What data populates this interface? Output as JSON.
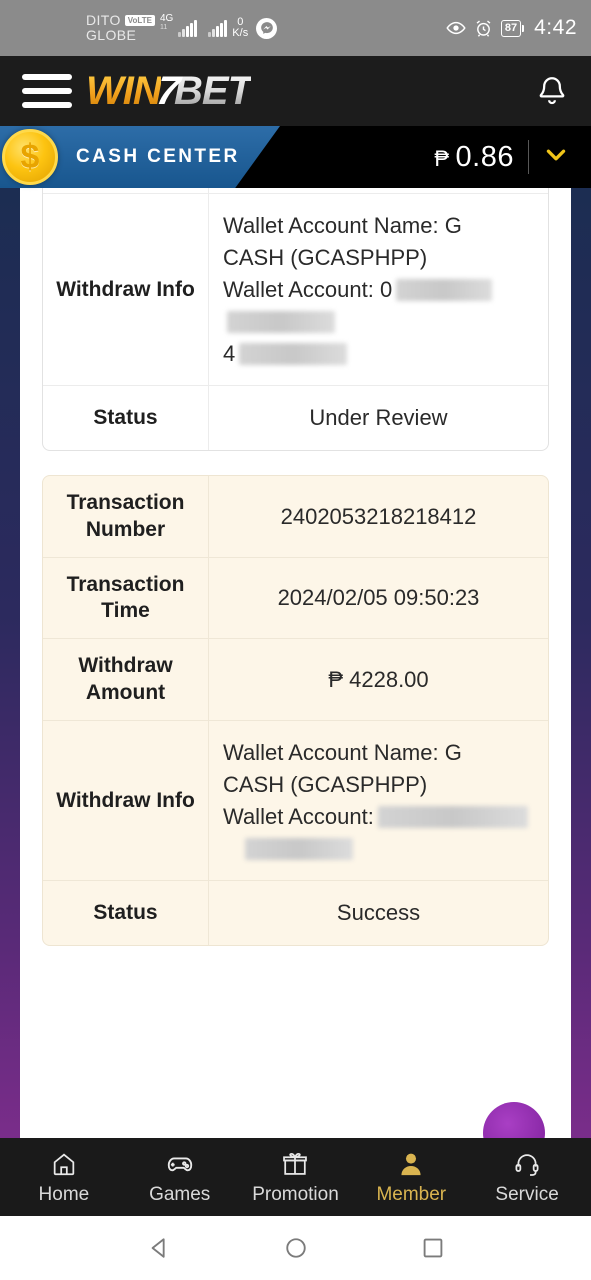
{
  "status_bar": {
    "carrier_primary": "DITO",
    "carrier_badge": "VoLTE",
    "carrier_secondary": "GLOBE",
    "network_type": "4G",
    "network_sub": "11",
    "data_rate_value": "0",
    "data_rate_unit": "K/s",
    "messenger_icon": "messenger-icon",
    "eye_icon": "eye-icon",
    "alarm_icon": "alarm-clock-icon",
    "battery_level": "87",
    "time": "4:42"
  },
  "header": {
    "menu_icon": "hamburger-menu-icon",
    "logo_win": "WIN",
    "logo_seven": "7",
    "logo_bet": "BET",
    "bell_icon": "notification-bell-icon"
  },
  "cash_center": {
    "coin_icon": "dollar-coin-icon",
    "title": "CASH CENTER",
    "currency_symbol": "₱",
    "balance": "0.86",
    "chevron_icon": "chevron-down-icon"
  },
  "transactions": [
    {
      "theme": "white",
      "partial_top": true,
      "rows": [
        {
          "label": "Withdraw Info",
          "type": "wallet",
          "wallet_name_line": "Wallet Account Name: G",
          "wallet_name_line2": "CASH (GCASPHPP)",
          "wallet_account_label": "Wallet Account:",
          "wallet_account_visible": "0",
          "wallet_account_visible2": "4",
          "redacted": true
        },
        {
          "label": "Status",
          "type": "text",
          "value": "Under Review"
        }
      ]
    },
    {
      "theme": "cream",
      "partial_top": false,
      "rows": [
        {
          "label": "Transaction Number",
          "type": "text",
          "value": "2402053218218412"
        },
        {
          "label": "Transaction Time",
          "type": "text",
          "value": "2024/02/05 09:50:23"
        },
        {
          "label": "Withdraw Amount",
          "type": "text",
          "value": "₱ 4228.00"
        },
        {
          "label": "Withdraw Info",
          "type": "wallet",
          "wallet_name_line": "Wallet Account Name: G",
          "wallet_name_line2": "CASH (GCASPHPP)",
          "wallet_account_label": "Wallet Account:",
          "wallet_account_visible": "",
          "wallet_account_visible2": "",
          "redacted": true
        },
        {
          "label": "Status",
          "type": "text",
          "value": "Success"
        }
      ]
    }
  ],
  "fab": {
    "name": "support-fab-button"
  },
  "bottom_nav": {
    "items": [
      {
        "label": "Home",
        "icon": "home-icon",
        "active": false
      },
      {
        "label": "Games",
        "icon": "gamepad-icon",
        "active": false
      },
      {
        "label": "Promotion",
        "icon": "gift-icon",
        "active": false
      },
      {
        "label": "Member",
        "icon": "person-icon",
        "active": true
      },
      {
        "label": "Service",
        "icon": "headset-icon",
        "active": false
      }
    ]
  },
  "android_nav": {
    "back_icon": "back-triangle-icon",
    "home_icon": "home-circle-icon",
    "recents_icon": "recents-square-icon"
  },
  "colors": {
    "accent_gold": "#d9b450",
    "cash_blue": "#1d5a93",
    "cream_card": "#fdf6e8",
    "fab_purple": "#8e2cab"
  }
}
